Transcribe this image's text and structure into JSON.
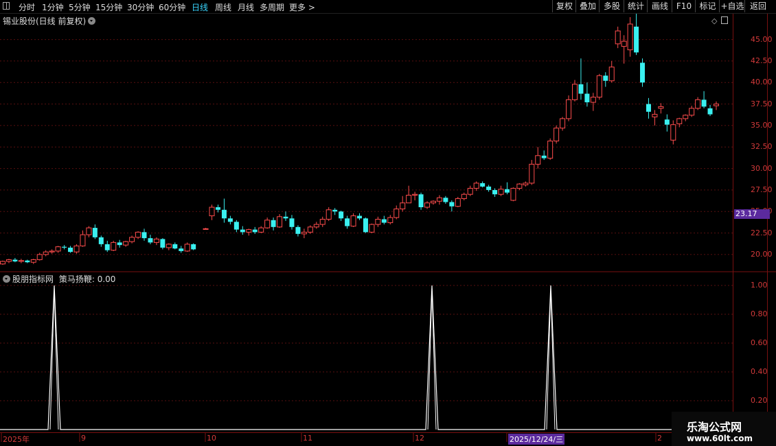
{
  "toolbar": {
    "periods": [
      "分时",
      "1分钟",
      "5分钟",
      "15分钟",
      "30分钟",
      "60分钟",
      "日线",
      "周线",
      "月线",
      "多周期",
      "更多 >"
    ],
    "active": "日线",
    "right_buttons": [
      "复权",
      "叠加",
      "多股",
      "统计",
      "画线",
      "F10",
      "标记",
      "+自选",
      "返回"
    ]
  },
  "stock": {
    "title": "锡业股份(日线 前复权)"
  },
  "price_axis": {
    "ticks": [
      "45.00",
      "42.50",
      "40.00",
      "37.50",
      "35.00",
      "32.50",
      "30.00",
      "27.50",
      "25.00",
      "22.50",
      "20.00"
    ],
    "current_label": "23.17"
  },
  "indicator": {
    "title": "股朋指标网",
    "name": "策马扬鞭",
    "value": "0.00",
    "axis_ticks": [
      "1.00",
      "0.80",
      "0.60",
      "0.40",
      "0.20"
    ]
  },
  "dates": [
    "2025年",
    "9",
    "10",
    "11",
    "12",
    "2025/12/24/三",
    "2"
  ],
  "watermark": {
    "name": "乐淘公式网",
    "url": "www.60lt.com"
  },
  "colors": {
    "up": "#ff4d4d",
    "down": "#3af0f0",
    "grid": "#5a0f0f",
    "active": "#3ad6ff"
  },
  "chart_data": {
    "type": "candlestick",
    "ylim": [
      18,
      48
    ],
    "candles": [
      [
        18.9,
        19.3,
        18.8,
        19.2
      ],
      [
        19.2,
        19.5,
        19.0,
        19.4
      ],
      [
        19.4,
        19.6,
        19.1,
        19.2
      ],
      [
        19.2,
        19.5,
        19.0,
        19.3
      ],
      [
        19.3,
        19.4,
        19.0,
        19.1
      ],
      [
        19.1,
        19.5,
        18.9,
        19.4
      ],
      [
        19.4,
        20.2,
        19.3,
        20.0
      ],
      [
        20.0,
        20.5,
        19.8,
        20.3
      ],
      [
        20.3,
        20.6,
        20.1,
        20.4
      ],
      [
        20.4,
        21.0,
        20.2,
        20.9
      ],
      [
        20.9,
        21.1,
        20.6,
        20.8
      ],
      [
        20.8,
        21.0,
        20.2,
        20.3
      ],
      [
        20.3,
        21.2,
        20.1,
        21.0
      ],
      [
        21.0,
        22.8,
        20.9,
        22.3
      ],
      [
        22.3,
        23.3,
        22.0,
        23.1
      ],
      [
        23.1,
        23.5,
        21.8,
        22.0
      ],
      [
        22.0,
        22.2,
        20.9,
        21.2
      ],
      [
        21.2,
        21.6,
        20.3,
        20.5
      ],
      [
        20.5,
        21.6,
        20.4,
        21.4
      ],
      [
        21.4,
        21.7,
        20.8,
        21.1
      ],
      [
        21.1,
        21.6,
        20.9,
        21.5
      ],
      [
        21.5,
        22.2,
        21.3,
        22.0
      ],
      [
        22.0,
        22.7,
        21.8,
        22.6
      ],
      [
        22.6,
        23.0,
        21.6,
        21.9
      ],
      [
        21.9,
        22.3,
        21.2,
        21.4
      ],
      [
        21.4,
        22.0,
        21.1,
        21.8
      ],
      [
        21.8,
        21.9,
        20.6,
        20.8
      ],
      [
        20.8,
        21.3,
        20.5,
        21.2
      ],
      [
        21.2,
        21.4,
        20.6,
        20.7
      ],
      [
        20.7,
        21.0,
        20.2,
        20.4
      ],
      [
        20.4,
        21.4,
        20.3,
        21.2
      ],
      [
        21.2,
        21.3,
        20.5,
        20.6
      ],
      [
        null,
        null,
        null,
        null
      ],
      [
        23.0,
        23.1,
        22.9,
        23.0
      ],
      [
        24.5,
        25.8,
        24.0,
        25.5
      ],
      [
        25.5,
        25.8,
        24.9,
        25.2
      ],
      [
        25.2,
        26.5,
        23.7,
        24.2
      ],
      [
        24.2,
        24.5,
        23.5,
        23.8
      ],
      [
        23.8,
        24.0,
        22.6,
        22.9
      ],
      [
        22.9,
        23.3,
        22.3,
        22.6
      ],
      [
        22.6,
        23.0,
        22.2,
        22.9
      ],
      [
        22.9,
        23.2,
        22.4,
        22.6
      ],
      [
        22.6,
        23.3,
        22.5,
        23.1
      ],
      [
        23.1,
        24.3,
        23.0,
        24.0
      ],
      [
        24.0,
        24.3,
        22.8,
        23.2
      ],
      [
        23.2,
        24.7,
        23.1,
        24.4
      ],
      [
        24.4,
        25.0,
        23.9,
        24.2
      ],
      [
        24.2,
        24.6,
        22.9,
        23.2
      ],
      [
        23.2,
        23.4,
        22.1,
        22.4
      ],
      [
        22.4,
        23.0,
        21.9,
        22.6
      ],
      [
        22.6,
        23.4,
        22.4,
        23.2
      ],
      [
        23.2,
        23.8,
        23.0,
        23.5
      ],
      [
        23.5,
        24.4,
        23.2,
        24.1
      ],
      [
        24.1,
        25.5,
        23.9,
        25.2
      ],
      [
        25.2,
        25.4,
        24.6,
        25.0
      ],
      [
        25.0,
        25.1,
        23.9,
        24.2
      ],
      [
        24.2,
        24.5,
        23.0,
        23.3
      ],
      [
        23.3,
        24.8,
        23.2,
        24.5
      ],
      [
        24.5,
        24.8,
        24.0,
        24.2
      ],
      [
        24.2,
        24.3,
        22.5,
        22.6
      ],
      [
        22.6,
        23.6,
        22.5,
        23.5
      ],
      [
        23.5,
        24.4,
        23.2,
        24.1
      ],
      [
        24.1,
        24.5,
        23.5,
        23.7
      ],
      [
        23.7,
        24.6,
        23.5,
        24.3
      ],
      [
        24.3,
        25.7,
        24.1,
        25.3
      ],
      [
        25.3,
        26.8,
        25.0,
        26.0
      ],
      [
        26.0,
        28.0,
        26.0,
        26.9
      ],
      [
        26.9,
        27.3,
        26.3,
        27.0
      ],
      [
        27.0,
        27.2,
        25.2,
        25.5
      ],
      [
        25.5,
        26.2,
        25.3,
        26.0
      ],
      [
        26.0,
        26.3,
        25.8,
        26.2
      ],
      [
        26.2,
        26.9,
        25.8,
        26.6
      ],
      [
        26.6,
        26.8,
        25.9,
        26.1
      ],
      [
        26.1,
        26.3,
        25.0,
        25.6
      ],
      [
        25.6,
        26.7,
        25.5,
        26.5
      ],
      [
        26.5,
        27.2,
        26.3,
        27.0
      ],
      [
        27.0,
        28.0,
        26.8,
        27.7
      ],
      [
        27.7,
        28.5,
        27.4,
        28.3
      ],
      [
        28.3,
        28.5,
        27.8,
        27.9
      ],
      [
        27.9,
        28.1,
        27.3,
        27.5
      ],
      [
        27.5,
        27.7,
        26.7,
        27.0
      ],
      [
        27.0,
        28.0,
        26.8,
        27.6
      ],
      [
        27.6,
        28.4,
        27.0,
        27.2
      ],
      [
        26.3,
        27.8,
        26.2,
        27.7
      ],
      [
        27.7,
        28.3,
        27.5,
        28.2
      ],
      [
        28.1,
        28.5,
        27.9,
        28.3
      ],
      [
        28.3,
        31.0,
        28.1,
        30.5
      ],
      [
        30.5,
        32.5,
        30.0,
        31.5
      ],
      [
        31.5,
        32.1,
        31.0,
        31.2
      ],
      [
        31.2,
        33.5,
        31.0,
        33.2
      ],
      [
        33.2,
        35.0,
        32.9,
        34.7
      ],
      [
        34.7,
        36.0,
        34.4,
        35.8
      ],
      [
        35.8,
        38.5,
        35.5,
        38.0
      ],
      [
        38.0,
        40.3,
        37.8,
        39.8
      ],
      [
        39.8,
        42.8,
        38.0,
        38.7
      ],
      [
        38.7,
        40.0,
        37.2,
        37.7
      ],
      [
        37.7,
        38.8,
        36.7,
        38.3
      ],
      [
        38.3,
        41.0,
        38.0,
        40.8
      ],
      [
        40.8,
        41.2,
        39.5,
        40.2
      ],
      [
        40.2,
        42.5,
        40.0,
        41.8
      ],
      [
        44.5,
        46.5,
        44.0,
        46.0
      ],
      [
        44.2,
        45.5,
        42.2,
        44.8
      ],
      [
        43.8,
        47.6,
        43.0,
        46.8
      ],
      [
        46.5,
        48.0,
        43.2,
        43.5
      ],
      [
        42.3,
        42.8,
        39.5,
        40.0
      ],
      [
        37.5,
        38.2,
        35.8,
        36.6
      ],
      [
        36.0,
        36.8,
        35.0,
        36.3
      ],
      [
        37.0,
        37.6,
        36.4,
        37.2
      ],
      [
        35.7,
        36.3,
        34.3,
        35.1
      ],
      [
        33.3,
        35.6,
        32.8,
        35.1
      ],
      [
        35.2,
        35.9,
        34.8,
        35.8
      ],
      [
        35.8,
        36.3,
        35.5,
        36.2
      ],
      [
        36.2,
        37.3,
        36.0,
        37.0
      ],
      [
        37.0,
        38.3,
        36.8,
        38.0
      ],
      [
        38.0,
        39.0,
        37.0,
        37.2
      ],
      [
        37.0,
        37.4,
        36.1,
        36.3
      ],
      [
        37.3,
        37.8,
        36.8,
        37.5
      ]
    ],
    "indicator_spikes": [
      1,
      1,
      1
    ],
    "indicator_ylim": [
      0,
      1
    ]
  }
}
